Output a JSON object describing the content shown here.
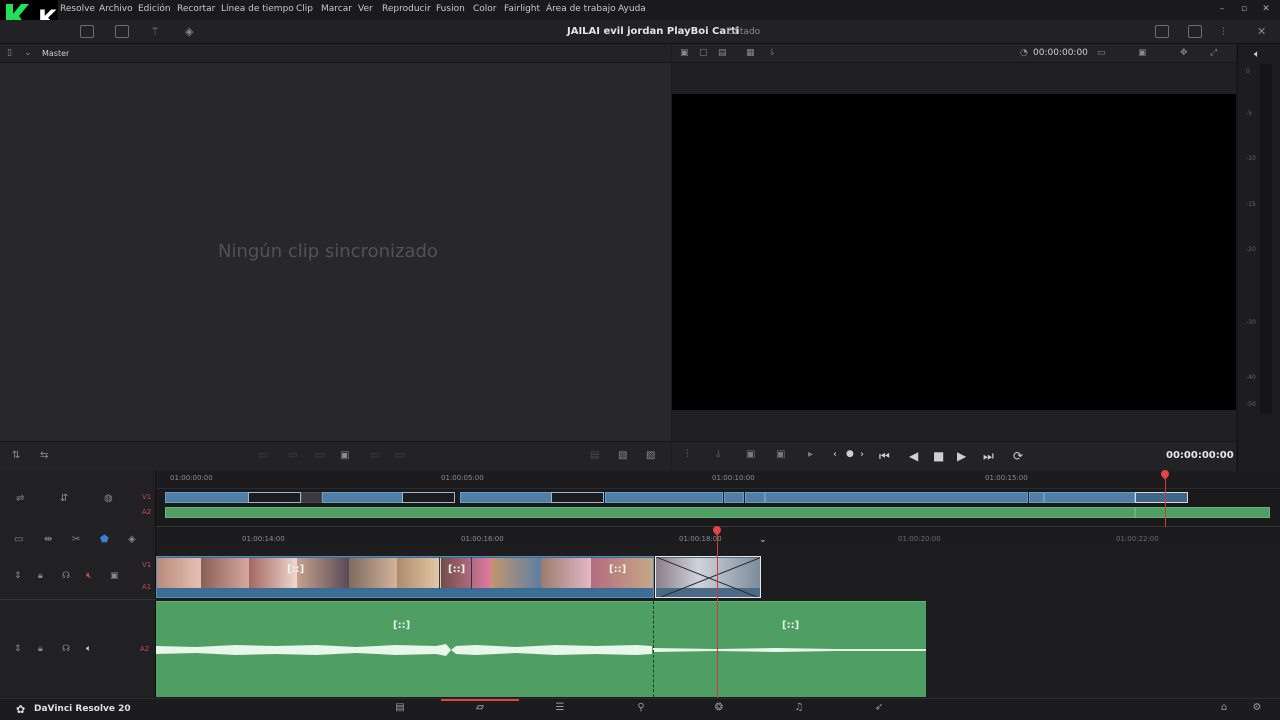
{
  "menu": [
    "Resolve",
    "Archivo",
    "Edición",
    "Recortar",
    "Línea de tiempo",
    "Clip",
    "Marcar",
    "Ver",
    "Reproducir",
    "Fusion",
    "Color",
    "Fairlight",
    "Área de trabajo",
    "Ayuda"
  ],
  "logo_text": "K2",
  "toolbar": {
    "project_title": "JAILAI evil jordan PlayBoi Carti",
    "status": "Editado"
  },
  "source_viewer": {
    "bin_label": "Master",
    "empty_message": "Ningún clip sincronizado"
  },
  "program_viewer": {
    "timecode_top": "00:00:00:00",
    "timecode": "00:00:00:00"
  },
  "meter_ticks": [
    "0",
    "-5",
    "-10",
    "-15",
    "-20",
    "-30",
    "-40",
    "-50"
  ],
  "timeline_upper": {
    "ruler": [
      "01:00:00:00",
      "01:00:05:00",
      "01:00:10:00",
      "01:00:15:00"
    ],
    "tracks": [
      "V1",
      "A2"
    ]
  },
  "timeline_lower": {
    "ruler": [
      "01:00:14:00",
      "01:00:16:00",
      "01:00:18:00",
      "01:00:20:00",
      "01:00:22:00"
    ],
    "tracks": [
      "V1",
      "A1",
      "A2"
    ],
    "fx_label": "[::]"
  },
  "footer": {
    "app_name": "DaVinci Resolve 20"
  },
  "colors": {
    "video_clip": "#4f7fa6",
    "audio_clip": "#4f9e64",
    "playhead": "#d23a3a",
    "active_page": "#e64040"
  },
  "icons": [
    "gear-icon",
    "home-icon",
    "speaker-icon",
    "play-icon",
    "stop-icon",
    "loop-icon",
    "skip-start-icon",
    "skip-end-icon"
  ]
}
